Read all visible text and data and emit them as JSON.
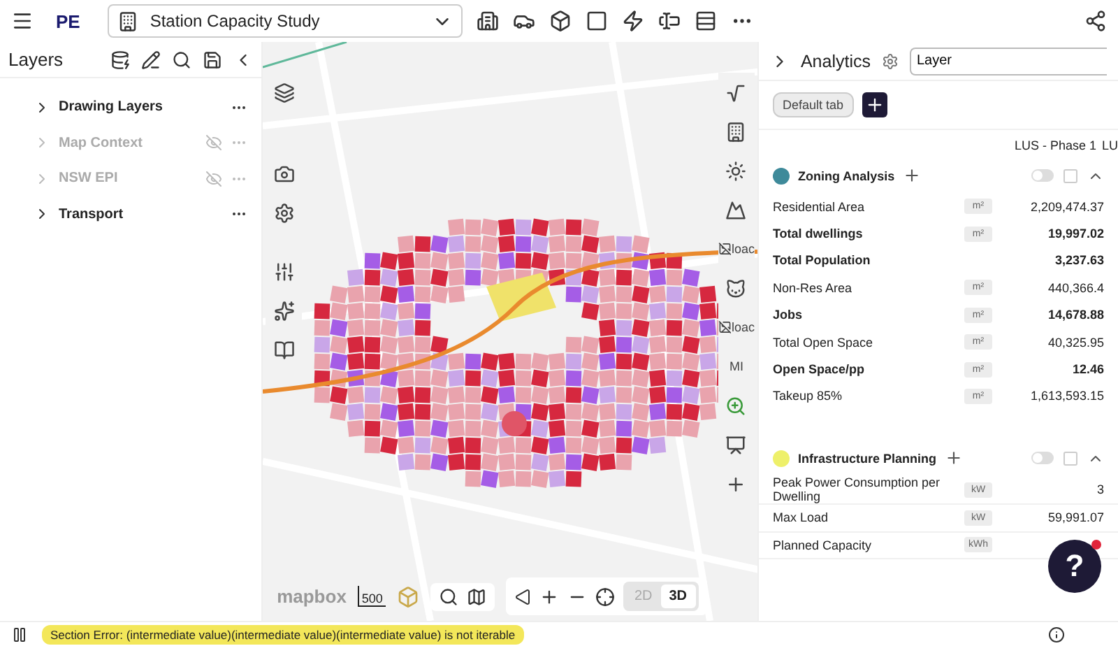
{
  "topbar": {
    "logo": "PE",
    "project": "Station Capacity Study"
  },
  "layers": {
    "title": "Layers",
    "items": [
      {
        "name": "Drawing Layers",
        "hidden": false
      },
      {
        "name": "Map Context",
        "hidden": true
      },
      {
        "name": "NSW EPI",
        "hidden": true
      },
      {
        "name": "Transport",
        "hidden": false
      }
    ]
  },
  "map": {
    "image_alts": [
      "loac",
      "loac",
      "MI"
    ],
    "scale": "500",
    "attribution": "mapbox",
    "view_modes": [
      {
        "label": "2D",
        "selected": false
      },
      {
        "label": "3D",
        "selected": true
      }
    ]
  },
  "analytics": {
    "title": "Analytics",
    "layer_field": {
      "value": "Layer"
    },
    "tabs": [
      {
        "label": "Default tab",
        "selected": true
      }
    ],
    "columns": [
      "LUS - Phase 1",
      "LU"
    ],
    "sections": [
      {
        "title": "Zoning Analysis",
        "color": "#3e8a9a",
        "on": false,
        "expanded": true,
        "rows": [
          {
            "label": "Residential Area",
            "unit": "m²",
            "value": "2,209,474.37",
            "emphasis": false
          },
          {
            "label": "Total dwellings",
            "unit": "m²",
            "value": "19,997.02",
            "emphasis": true
          },
          {
            "label": "Total Population",
            "unit": "",
            "value": "3,237.63",
            "emphasis": true
          },
          {
            "label": "Non-Res Area",
            "unit": "m²",
            "value": "440,366.4",
            "emphasis": false
          },
          {
            "label": "Jobs",
            "unit": "m²",
            "value": "14,678.88",
            "emphasis": true
          },
          {
            "label": "Total Open Space",
            "unit": "m²",
            "value": "40,325.95",
            "emphasis": false
          },
          {
            "label": "Open Space/pp",
            "unit": "m²",
            "value": "12.46",
            "emphasis": true
          },
          {
            "label": "Takeup 85%",
            "unit": "m²",
            "value": "1,613,593.15",
            "emphasis": false
          }
        ]
      },
      {
        "title": "Infrastructure Planning",
        "color": "#eef06a",
        "on": false,
        "expanded": true,
        "rows": [
          {
            "label": "Peak Power Consumption per Dwelling",
            "unit": "kW",
            "value": "3",
            "emphasis": false
          },
          {
            "label": "Max Load",
            "unit": "kW",
            "value": "59,991.07",
            "emphasis": false
          },
          {
            "label": "Planned Capacity",
            "unit": "kWh",
            "value": "",
            "emphasis": false
          }
        ]
      }
    ]
  },
  "help": {
    "label": "?",
    "notification": true
  },
  "status": {
    "error": "Section Error: (intermediate value)(intermediate value)(intermediate value) is not iterable"
  }
}
